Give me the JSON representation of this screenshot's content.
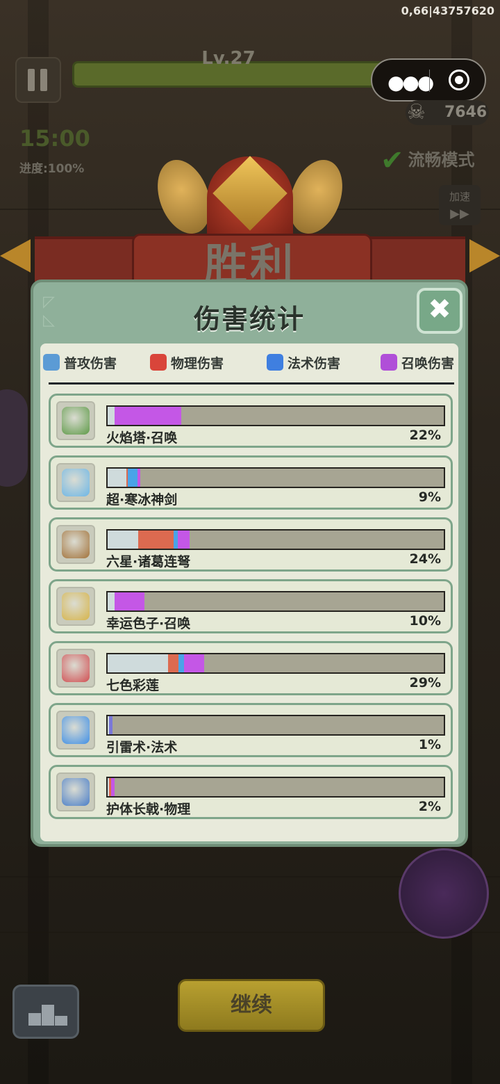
{
  "top_id": "0,66|43757620",
  "hud": {
    "level": "Lv.27",
    "kills": "7646",
    "timer": "15:00",
    "progress": "进度:100%",
    "smooth_mode": "流畅模式",
    "speed_label": "加速",
    "speed_arrow": "▶▶"
  },
  "banner": {
    "victory": "胜利"
  },
  "panel": {
    "title": "伤害统计",
    "close_glyph": "✖",
    "tabs": [
      {
        "label": "普攻伤害",
        "color": "#5b9bd5"
      },
      {
        "label": "物理伤害",
        "color": "#d9453a"
      },
      {
        "label": "法术伤害",
        "color": "#3f7fe0"
      },
      {
        "label": "召唤伤害",
        "color": "#b04fd8"
      }
    ],
    "rows": [
      {
        "name": "火焰塔·召唤",
        "percent": "22%",
        "icon_color": "#5e9a48",
        "segments": [
          {
            "kind": "normal",
            "fraction": 0.02,
            "color": "#cfdbdc"
          },
          {
            "kind": "summon",
            "fraction": 0.2,
            "color": "#c457e6"
          }
        ]
      },
      {
        "name": "超·寒冰神剑",
        "percent": "9%",
        "icon_color": "#6cb6e6",
        "segments": [
          {
            "kind": "normal",
            "fraction": 0.055,
            "color": "#cfdbdc"
          },
          {
            "kind": "physical",
            "fraction": 0.005,
            "color": "#dc6a50"
          },
          {
            "kind": "magic",
            "fraction": 0.028,
            "color": "#4aa3e8"
          },
          {
            "kind": "summon",
            "fraction": 0.01,
            "color": "#c457e6"
          }
        ]
      },
      {
        "name": "六星·诸葛连弩",
        "percent": "24%",
        "icon_color": "#a2723a",
        "segments": [
          {
            "kind": "normal",
            "fraction": 0.09,
            "color": "#cfdbdc"
          },
          {
            "kind": "physical",
            "fraction": 0.107,
            "color": "#dc6a50"
          },
          {
            "kind": "magic",
            "fraction": 0.012,
            "color": "#4aa3e8"
          },
          {
            "kind": "summon",
            "fraction": 0.035,
            "color": "#c457e6"
          }
        ]
      },
      {
        "name": "幸运色子·召唤",
        "percent": "10%",
        "icon_color": "#d6b44a",
        "segments": [
          {
            "kind": "normal",
            "fraction": 0.02,
            "color": "#cfdbdc"
          },
          {
            "kind": "summon",
            "fraction": 0.09,
            "color": "#c457e6"
          }
        ]
      },
      {
        "name": "七色彩莲",
        "percent": "29%",
        "icon_color": "#d14e52",
        "segments": [
          {
            "kind": "normal",
            "fraction": 0.18,
            "color": "#cfdbdc"
          },
          {
            "kind": "physical",
            "fraction": 0.03,
            "color": "#dc6a50"
          },
          {
            "kind": "magic",
            "fraction": 0.018,
            "color": "#4aa3e8"
          },
          {
            "kind": "summon",
            "fraction": 0.06,
            "color": "#c457e6"
          }
        ]
      },
      {
        "name": "引雷术·法术",
        "percent": "1%",
        "icon_color": "#3f8fe6",
        "segments": [
          {
            "kind": "normal",
            "fraction": 0.005,
            "color": "#cfdbdc"
          },
          {
            "kind": "magic",
            "fraction": 0.01,
            "color": "#7a78d8"
          }
        ]
      },
      {
        "name": "护体长戟·物理",
        "percent": "2%",
        "icon_color": "#4a7ec8",
        "segments": [
          {
            "kind": "normal",
            "fraction": 0.005,
            "color": "#cfdbdc"
          },
          {
            "kind": "physical",
            "fraction": 0.006,
            "color": "#dc6a50"
          },
          {
            "kind": "summon",
            "fraction": 0.009,
            "color": "#c457e6"
          }
        ]
      }
    ]
  },
  "buttons": {
    "continue": "继续"
  }
}
